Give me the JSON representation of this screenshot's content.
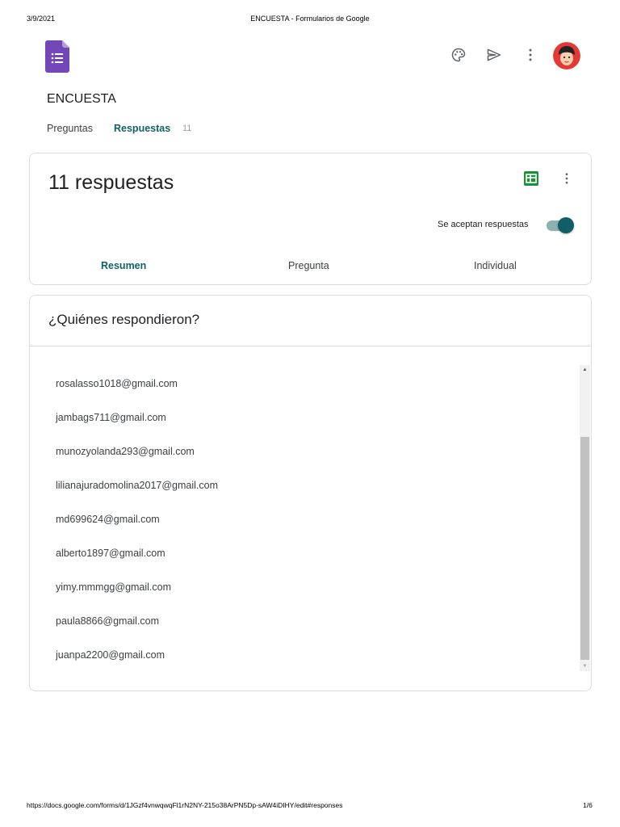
{
  "print": {
    "date": "3/9/2021",
    "title": "ENCUESTA - Formularios de Google",
    "url": "https://docs.google.com/forms/d/1JGzf4vnwqwqFl1rN2NY-215o38ArPN5Dp-sAW4iDIHY/edit#responses",
    "page": "1/6"
  },
  "app": {
    "form_title": "ENCUESTA",
    "accent_color": "#136262",
    "logo_color": "#7248b9",
    "icons": [
      "forms-logo-icon",
      "palette-icon",
      "send-icon",
      "more-vert-icon",
      "avatar"
    ]
  },
  "tabs": {
    "preguntas": "Preguntas",
    "respuestas": "Respuestas",
    "respuestas_count": "11"
  },
  "summary": {
    "count_label": "11 respuestas",
    "accepting_label": "Se aceptan respuestas",
    "accepting": true,
    "subtabs": [
      "Resumen",
      "Pregunta",
      "Individual"
    ]
  },
  "who": {
    "title": "¿Quiénes respondieron?",
    "emails": [
      "rosalasso1018@gmail.com",
      "jambags711@gmail.com",
      "munozyolanda293@gmail.com",
      "lilianajuradomolina2017@gmail.com",
      "md699624@gmail.com",
      "alberto1897@gmail.com",
      "yimy.mmmgg@gmail.com",
      "paula8866@gmail.com",
      "juanpa2200@gmail.com"
    ]
  }
}
